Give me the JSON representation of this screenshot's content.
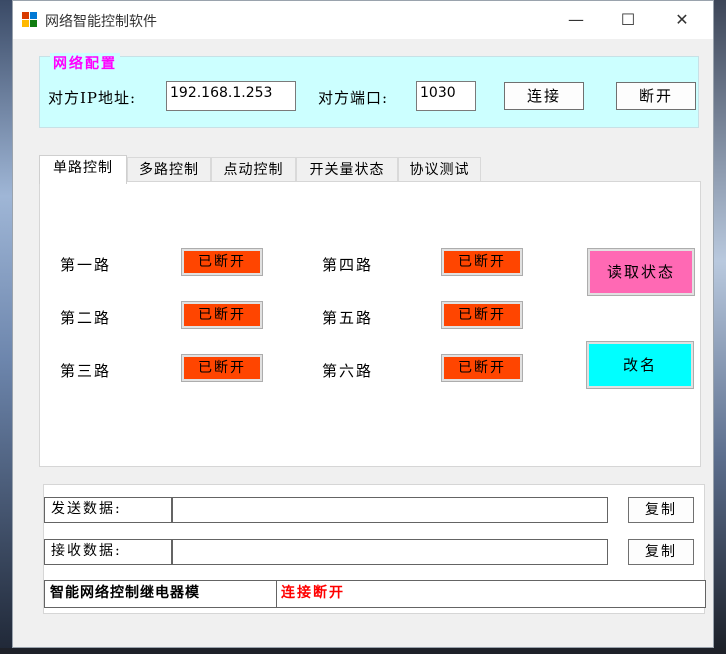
{
  "window": {
    "title": "网络智能控制软件",
    "minimize_glyph": "—",
    "maximize_glyph": "☐",
    "close_glyph": "✕"
  },
  "network_config": {
    "legend": "网络配置",
    "ip_label": "对方IP地址:",
    "ip_value": "192.168.1.253",
    "port_label": "对方端口:",
    "port_value": "1030",
    "connect_label": "连接",
    "disconnect_label": "断开"
  },
  "tabs": [
    {
      "label": "单路控制",
      "active": true
    },
    {
      "label": "多路控制",
      "active": false
    },
    {
      "label": "点动控制",
      "active": false
    },
    {
      "label": "开关量状态",
      "active": false
    },
    {
      "label": "协议测试",
      "active": false
    }
  ],
  "routes": [
    {
      "name": "第一路",
      "state": "已断开"
    },
    {
      "name": "第二路",
      "state": "已断开"
    },
    {
      "name": "第三路",
      "state": "已断开"
    },
    {
      "name": "第四路",
      "state": "已断开"
    },
    {
      "name": "第五路",
      "state": "已断开"
    },
    {
      "name": "第六路",
      "state": "已断开"
    }
  ],
  "actions": {
    "read_status_label": "读取状态",
    "rename_label": "改名"
  },
  "data_panel": {
    "send_label": "发送数据:",
    "send_value": "",
    "receive_label": "接收数据:",
    "receive_value": "",
    "copy_label": "复制"
  },
  "status": {
    "device_name": "智能网络控制继电器模",
    "connection_state": "连接断开"
  },
  "colors": {
    "config_bg": "#ccffff",
    "legend_text": "#ff00ff",
    "state_off": "#ff4500",
    "read_status_bg": "#ff69b4",
    "rename_bg": "#00ffff",
    "status_text": "#ff0000"
  }
}
